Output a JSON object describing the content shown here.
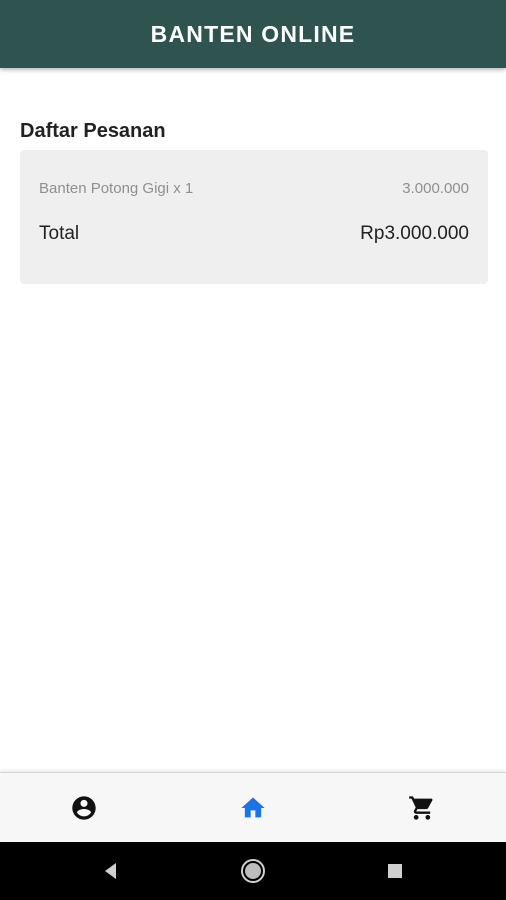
{
  "app": {
    "title": "BANTEN ONLINE"
  },
  "orders": {
    "section_title": "Daftar Pesanan",
    "items": [
      {
        "label": "Banten Potong Gigi x 1",
        "price": "3.000.000"
      }
    ],
    "total_label": "Total",
    "total_value": "Rp3.000.000"
  },
  "bottom_nav": {
    "items": [
      {
        "icon": "account-circle-icon",
        "active": false
      },
      {
        "icon": "home-icon",
        "active": true
      },
      {
        "icon": "shopping-cart-icon",
        "active": false
      }
    ],
    "active_color": "#1a73e8",
    "inactive_color": "#111111"
  },
  "colors": {
    "app_bar": "#2f5450",
    "card_background": "#efefef"
  }
}
